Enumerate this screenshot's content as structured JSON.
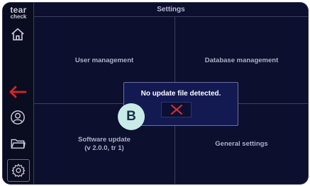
{
  "app": {
    "logo_top": "tear",
    "logo_bottom": "check",
    "title": "Settings"
  },
  "sidebar": {
    "items": [
      {
        "name": "home",
        "icon": "home-icon"
      },
      {
        "name": "back",
        "icon": "arrow-left-icon",
        "color": "#d8232a"
      },
      {
        "name": "patient",
        "icon": "user-icon"
      },
      {
        "name": "files",
        "icon": "folder-icon"
      },
      {
        "name": "settings",
        "icon": "gear-icon",
        "selected": true
      }
    ]
  },
  "menu": {
    "user_management": "User management",
    "database_management": "Database management",
    "software_update_line1": "Software update",
    "software_update_line2": "(v 2.0.0, tr 1)",
    "general_settings": "General settings"
  },
  "dialog": {
    "message": "No update file detected.",
    "close_icon": "close-x-icon",
    "close_color": "#e0312f"
  },
  "badge": {
    "label": "B",
    "color": "#c9ebe7"
  }
}
